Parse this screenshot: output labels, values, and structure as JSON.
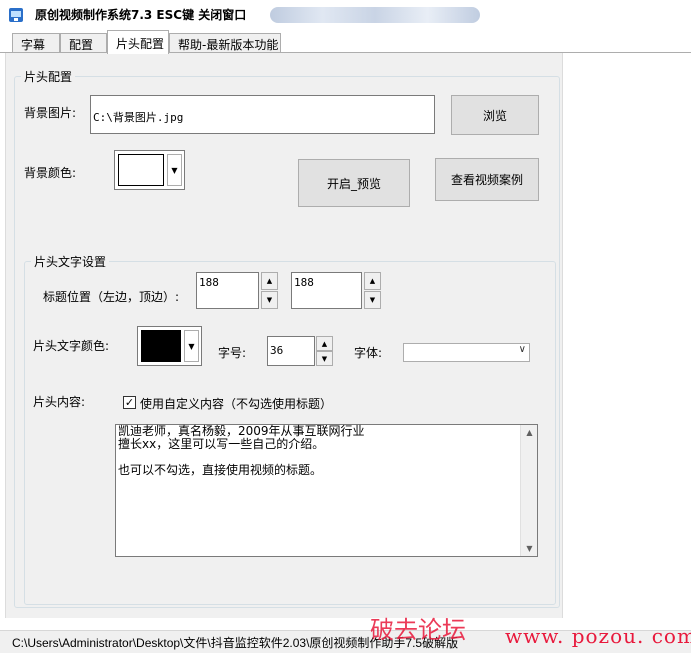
{
  "window": {
    "title": "原创视频制作系统7.3    ESC键 关闭窗口"
  },
  "tabs": [
    {
      "label": "字幕"
    },
    {
      "label": "配置"
    },
    {
      "label": "片头配置",
      "active": true
    },
    {
      "label": "帮助-最新版本功能"
    }
  ],
  "intro_config": {
    "group_label": "片头配置",
    "bg_image": {
      "label": "背景图片:",
      "value": "C:\\背景图片.jpg",
      "browse_label": "浏览"
    },
    "bg_color": {
      "label": "背景颜色:",
      "color": "#ffffff"
    },
    "preview_label": "开启_预览",
    "examples_label": "查看视频案例"
  },
  "text_settings": {
    "group_label": "片头文字设置",
    "title_position": {
      "label": "标题位置（左边，顶边）:",
      "left": "188",
      "top": "188"
    },
    "text_color": {
      "label": "片头文字颜色:",
      "color": "#000000"
    },
    "font_size": {
      "label": "字号:",
      "value": "36"
    },
    "font": {
      "label": "字体:",
      "value": ""
    },
    "content": {
      "label": "片头内容:",
      "custom_checkbox_label": "使用自定义内容（不勾选使用标题）",
      "custom_checked": true,
      "text": "凯迪老师，真名杨毅，2009年从事互联网行业\n擅长xx，这里可以写一些自己的介绍。\n\n也可以不勾选，直接使用视频的标题。"
    }
  },
  "status_bar": {
    "path": "C:\\Users\\Administrator\\Desktop\\文件\\抖音监控软件2.03\\原创视频制作助手7.5破解版"
  },
  "watermark": {
    "cn": "破去论坛",
    "url": "www. pozou. com"
  },
  "colors": {
    "panel_bg": "#f0f0f0",
    "watermark": "#e8193c",
    "button_bg": "#e1e1e1"
  }
}
